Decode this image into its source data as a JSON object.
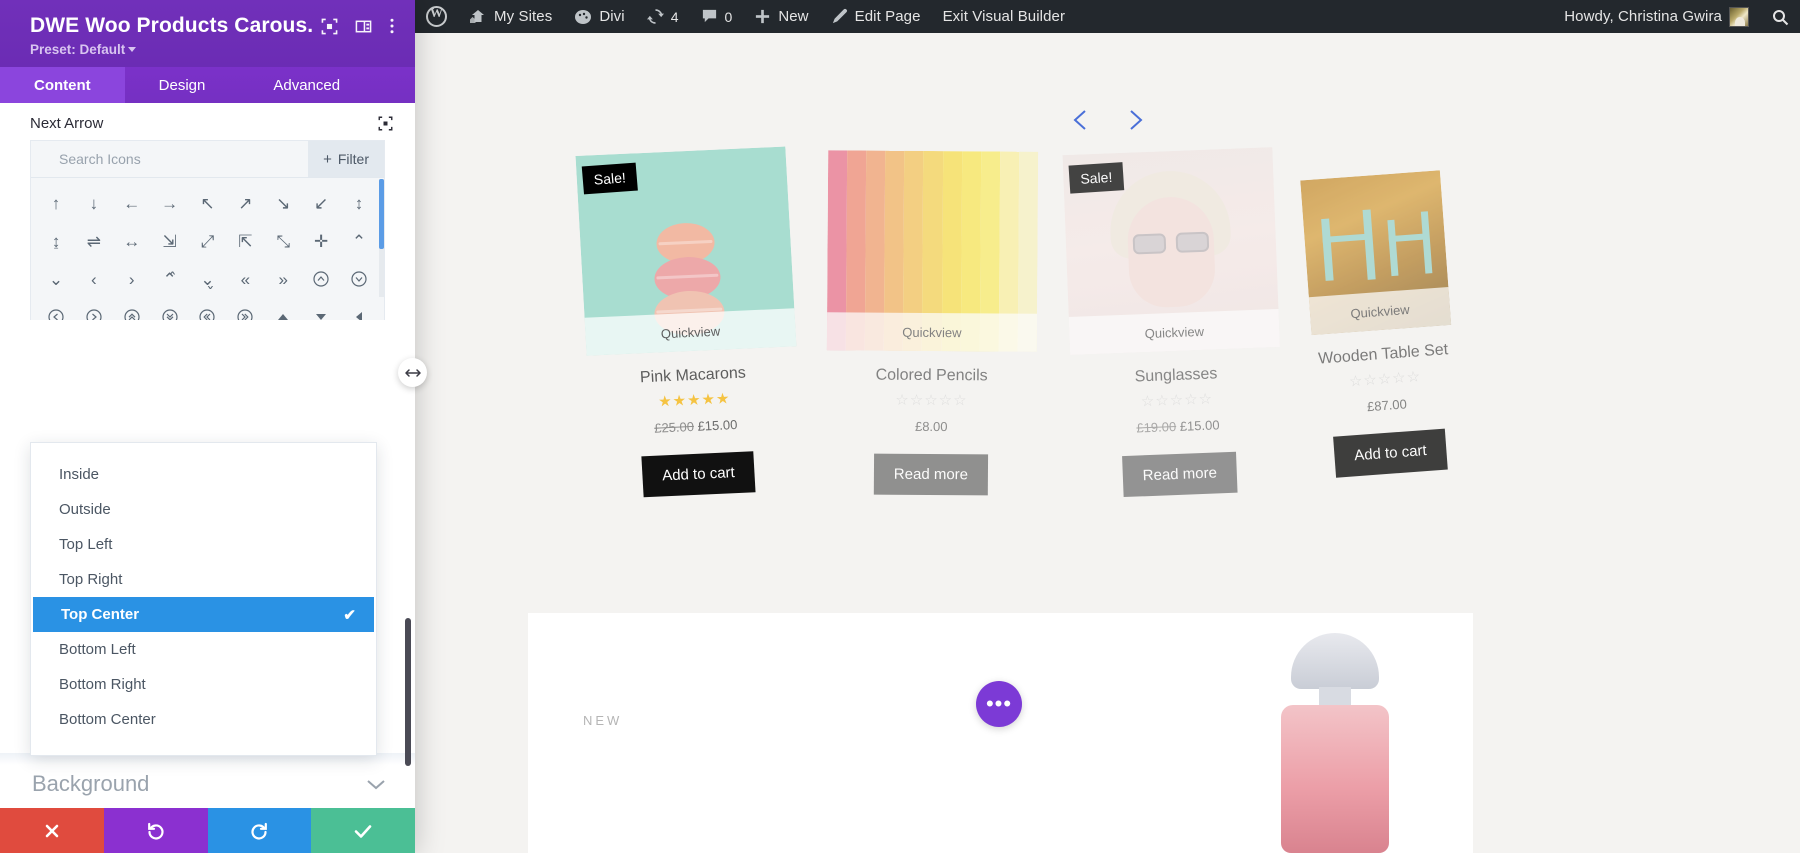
{
  "adminbar": {
    "wp_logo": "wordpress-logo-icon",
    "items": [
      {
        "name": "my-sites",
        "label": "My Sites",
        "icon": "sites-icon"
      },
      {
        "name": "divi",
        "label": "Divi",
        "icon": "divi-icon"
      },
      {
        "name": "updates",
        "label": "4",
        "icon": "updates-icon"
      },
      {
        "name": "comments",
        "label": "0",
        "icon": "comment-icon"
      },
      {
        "name": "new",
        "label": "New",
        "icon": "plus-icon"
      },
      {
        "name": "edit-page",
        "label": "Edit Page",
        "icon": "pencil-icon"
      },
      {
        "name": "exit-visual-builder",
        "label": "Exit Visual Builder",
        "icon": ""
      }
    ],
    "howdy": "Howdy, Christina Gwira",
    "search_icon": "search-icon"
  },
  "panel": {
    "title": "DWE Woo Products Carous...",
    "preset_label": "Preset: Default",
    "header_icons": [
      "focus-target-icon",
      "layout-columns-icon",
      "kebab-menu-icon"
    ],
    "tabs": [
      {
        "name": "content",
        "label": "Content",
        "active": true
      },
      {
        "name": "design",
        "label": "Design",
        "active": false
      },
      {
        "name": "advanced",
        "label": "Advanced",
        "active": false
      }
    ],
    "field": {
      "label": "Next Arrow",
      "responsive_icon": "focus-target-icon"
    },
    "icon_picker": {
      "search_placeholder": "Search Icons",
      "filter_label": "Filter",
      "rows": [
        [
          "arrow-up",
          "arrow-down",
          "arrow-left",
          "arrow-right",
          "arrow-up-left",
          "arrow-up-right",
          "arrow-down-right",
          "arrow-down-left",
          "arrows-vertical"
        ],
        [
          "arrows-updown",
          "arrows-exchange",
          "arrows-horizontal",
          "arrow-diag-down-right",
          "arrow-diag-expand",
          "arrows-collapse",
          "arrows-expand",
          "arrows-move",
          "chevron-up"
        ],
        [
          "chevron-down",
          "chevron-left",
          "chevron-right",
          "chevron-double-up",
          "chevron-double-down",
          "chevron-double-left",
          "chevron-double-right",
          "circle-chevron-up",
          "circle-chevron-down"
        ],
        [
          "circle-chevron-left",
          "circle-chevron-right",
          "circle-double-up",
          "circle-double-down",
          "circle-double-left",
          "circle-double-right",
          "triangle-up",
          "triangle-down",
          "triangle-left"
        ]
      ]
    },
    "dropdown": {
      "options": [
        {
          "label": "Inside",
          "selected": false
        },
        {
          "label": "Outside",
          "selected": false
        },
        {
          "label": "Top Left",
          "selected": false
        },
        {
          "label": "Top Right",
          "selected": false
        },
        {
          "label": "Top Center",
          "selected": true
        },
        {
          "label": "Bottom Left",
          "selected": false
        },
        {
          "label": "Bottom Right",
          "selected": false
        },
        {
          "label": "Bottom Center",
          "selected": false
        }
      ],
      "check_glyph": "✔"
    },
    "section": {
      "label": "Background",
      "chevron": "chevron-down-icon"
    },
    "footer": [
      {
        "name": "cancel",
        "icon": "close-x-icon",
        "color": "#e04b3e"
      },
      {
        "name": "undo",
        "icon": "undo-icon",
        "color": "#8b30d0"
      },
      {
        "name": "redo",
        "icon": "redo-icon",
        "color": "#2a92e4"
      },
      {
        "name": "save",
        "icon": "check-icon",
        "color": "#4bbf95"
      }
    ],
    "drag_handle_icon": "horizontal-resize-icon"
  },
  "canvas": {
    "nav": {
      "prev": "chevron-left-icon",
      "next": "chevron-right-icon",
      "color": "#4a6fd8"
    },
    "products": [
      {
        "name": "Pink Macarons",
        "badge": "Sale!",
        "quickview": "Quickview",
        "stars_filled": 5,
        "price_old": "£25.00",
        "price_new": "£15.00",
        "button": "Add to cart"
      },
      {
        "name": "Colored Pencils",
        "badge": "",
        "quickview": "Quickview",
        "stars_filled": 0,
        "price_old": "",
        "price_new": "£8.00",
        "button": "Read more"
      },
      {
        "name": "Sunglasses",
        "badge": "Sale!",
        "quickview": "Quickview",
        "stars_filled": 0,
        "price_old": "£19.00",
        "price_new": "£15.00",
        "button": "Read more"
      },
      {
        "name": "Wooden Table Set",
        "badge": "",
        "quickview": "Quickview",
        "stars_filled": 0,
        "price_old": "",
        "price_new": "£87.00",
        "button": "Add to cart"
      }
    ],
    "new_section": {
      "eyebrow": "NEW"
    },
    "dots_button": {
      "label": "•••",
      "color": "#7c3ad6"
    }
  }
}
